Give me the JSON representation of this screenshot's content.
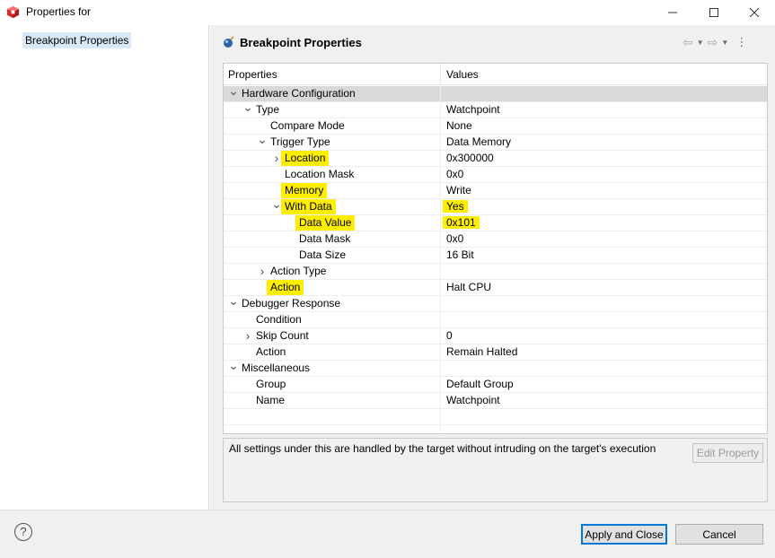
{
  "window": {
    "title": "Properties for"
  },
  "left_tree": {
    "selected": "Breakpoint Properties"
  },
  "page": {
    "title": "Breakpoint Properties"
  },
  "table": {
    "headers": [
      "Properties",
      "Values"
    ],
    "rows": [
      {
        "level": 0,
        "twisty": "open",
        "label": "Hardware Configuration",
        "value": "",
        "selected": true,
        "highlight_label": false,
        "highlight_value": false
      },
      {
        "level": 1,
        "twisty": "open",
        "label": "Type",
        "value": "Watchpoint",
        "selected": false,
        "highlight_label": false,
        "highlight_value": false
      },
      {
        "level": 2,
        "twisty": "none",
        "label": "Compare Mode",
        "value": "None",
        "selected": false,
        "highlight_label": false,
        "highlight_value": false
      },
      {
        "level": 2,
        "twisty": "open",
        "label": "Trigger Type",
        "value": "Data Memory",
        "selected": false,
        "highlight_label": false,
        "highlight_value": false
      },
      {
        "level": 3,
        "twisty": "closed",
        "label": "Location",
        "value": "0x300000",
        "selected": false,
        "highlight_label": true,
        "highlight_value": false
      },
      {
        "level": 3,
        "twisty": "none",
        "label": "Location Mask",
        "value": "0x0",
        "selected": false,
        "highlight_label": false,
        "highlight_value": false
      },
      {
        "level": 3,
        "twisty": "none",
        "label": "Memory",
        "value": "Write",
        "selected": false,
        "highlight_label": true,
        "highlight_value": false
      },
      {
        "level": 3,
        "twisty": "open",
        "label": "With Data",
        "value": "Yes",
        "selected": false,
        "highlight_label": true,
        "highlight_value": true
      },
      {
        "level": 4,
        "twisty": "none",
        "label": "Data Value",
        "value": "0x101",
        "selected": false,
        "highlight_label": true,
        "highlight_value": true
      },
      {
        "level": 4,
        "twisty": "none",
        "label": "Data Mask",
        "value": "0x0",
        "selected": false,
        "highlight_label": false,
        "highlight_value": false
      },
      {
        "level": 4,
        "twisty": "none",
        "label": "Data Size",
        "value": "16 Bit",
        "selected": false,
        "highlight_label": false,
        "highlight_value": false
      },
      {
        "level": 2,
        "twisty": "closed",
        "label": "Action Type",
        "value": "",
        "selected": false,
        "highlight_label": false,
        "highlight_value": false
      },
      {
        "level": 2,
        "twisty": "none",
        "label": "Action",
        "value": "Halt CPU",
        "selected": false,
        "highlight_label": true,
        "highlight_value": false
      },
      {
        "level": 0,
        "twisty": "open",
        "label": "Debugger Response",
        "value": "",
        "selected": false,
        "highlight_label": false,
        "highlight_value": false
      },
      {
        "level": 1,
        "twisty": "none",
        "label": "Condition",
        "value": "",
        "selected": false,
        "highlight_label": false,
        "highlight_value": false
      },
      {
        "level": 1,
        "twisty": "closed",
        "label": "Skip Count",
        "value": "0",
        "selected": false,
        "highlight_label": false,
        "highlight_value": false
      },
      {
        "level": 1,
        "twisty": "none",
        "label": "Action",
        "value": "Remain Halted",
        "selected": false,
        "highlight_label": false,
        "highlight_value": false
      },
      {
        "level": 0,
        "twisty": "open",
        "label": "Miscellaneous",
        "value": "",
        "selected": false,
        "highlight_label": false,
        "highlight_value": false
      },
      {
        "level": 1,
        "twisty": "none",
        "label": "Group",
        "value": "Default Group",
        "selected": false,
        "highlight_label": false,
        "highlight_value": false
      },
      {
        "level": 1,
        "twisty": "none",
        "label": "Name",
        "value": "Watchpoint",
        "selected": false,
        "highlight_label": false,
        "highlight_value": false
      },
      {
        "level": 0,
        "twisty": "none",
        "label": "",
        "value": "",
        "selected": false,
        "highlight_label": false,
        "highlight_value": false
      },
      {
        "level": 0,
        "twisty": "none",
        "label": "",
        "value": "",
        "selected": false,
        "highlight_label": false,
        "highlight_value": false
      }
    ]
  },
  "description": {
    "text": "All settings under this are handled by the target without intruding on the target's execution",
    "edit_button": "Edit Property"
  },
  "buttons": {
    "apply_close": "Apply and Close",
    "cancel": "Cancel"
  },
  "colors": {
    "highlight": "#ffee00",
    "selection": "#d9e8f8",
    "row_selected": "#d9d9d9"
  }
}
